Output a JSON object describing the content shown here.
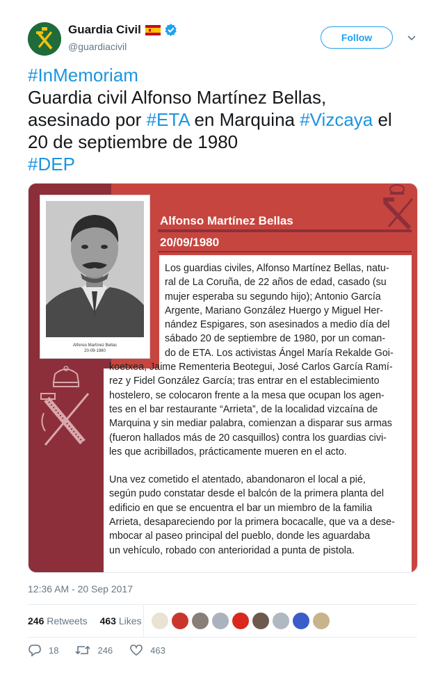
{
  "author": {
    "display_name": "Guardia Civil",
    "handle": "@guardiacivil",
    "verified": true,
    "flag": "spain-flag-icon"
  },
  "follow_button": {
    "label": "Follow"
  },
  "tweet": {
    "lines": [
      [
        {
          "t": "#InMemoriam",
          "h": true
        }
      ],
      [
        {
          "t": "Guardia civil Alfonso Martínez Bellas,",
          "h": false
        }
      ],
      [
        {
          "t": "asesinado por ",
          "h": false
        },
        {
          "t": "#ETA",
          "h": true
        },
        {
          "t": " en Marquina ",
          "h": false
        },
        {
          "t": "#Vizcaya",
          "h": true
        },
        {
          "t": " el",
          "h": false
        }
      ],
      [
        {
          "t": "20 de septiembre de 1980",
          "h": false
        }
      ],
      [
        {
          "t": "#DEP",
          "h": true
        }
      ]
    ]
  },
  "media": {
    "photo_caption_name": "Alfonso Martínez Bellas",
    "photo_caption_date": "20-09-1980",
    "name": "Alfonso Martínez Bellas",
    "date": "20/09/1980",
    "body_lines": [
      "Los guardias civiles, Alfonso Martínez Bellas,  natu-",
      "ral de La Coruña, de 22 años de edad, casado (su",
      "mujer esperaba su segundo hijo); Antonio García",
      "Argente, Mariano González Huergo y Miguel Her-",
      "nández Espigares, son asesinados a medio día del",
      "sábado 20 de septiembre de 1980, por un coman-",
      "do de ETA. Los activistas Ángel María Rekalde Goi-",
      "koetxea, Jaime Rementeria Beotegui, José Carlos García Ramí-",
      "rez y Fidel González García; tras entrar en el establecimiento",
      "hostelero, se colocaron frente a la mesa que ocupan los agen-",
      "tes en el bar restaurante “Arrieta”, de la localidad vizcaína de",
      "Marquina y sin mediar palabra, comienzan a disparar sus armas",
      "(fueron hallados más de 20 casquillos) contra los guardias civi-",
      "les que acribillados, prácticamente mueren en el acto.",
      "",
      "Una vez cometido el atentado, abandonaron el local a pié,",
      "según pudo constatar desde el balcón de la primera planta del",
      "edificio en que se encuentra el bar un miembro de la familia",
      "Arrieta, desapareciendo por la primera bocacalle, que va a dese-",
      "mbocar al paseo principal del pueblo, donde les aguardaba",
      "un vehículo, robado con anterioridad a punta de pistola."
    ]
  },
  "timestamp": "12:36 AM - 20 Sep 2017",
  "stats": {
    "retweets_count": "246",
    "retweets_label": "Retweets",
    "likes_count": "463",
    "likes_label": "Likes"
  },
  "liker_avatar_colors": [
    "#e9e3d2",
    "#c9372c",
    "#8a7f78",
    "#aab3bd",
    "#d9291c",
    "#6d5a4e",
    "#b0b8c2",
    "#3b5dc9",
    "#c8b48a"
  ],
  "actions": {
    "replies": "18",
    "retweets": "246",
    "likes": "463"
  },
  "colors": {
    "link": "#1b95e0",
    "follow": "#1da1f2",
    "media_red": "#c7453f",
    "media_dark": "#8c2f3b"
  }
}
